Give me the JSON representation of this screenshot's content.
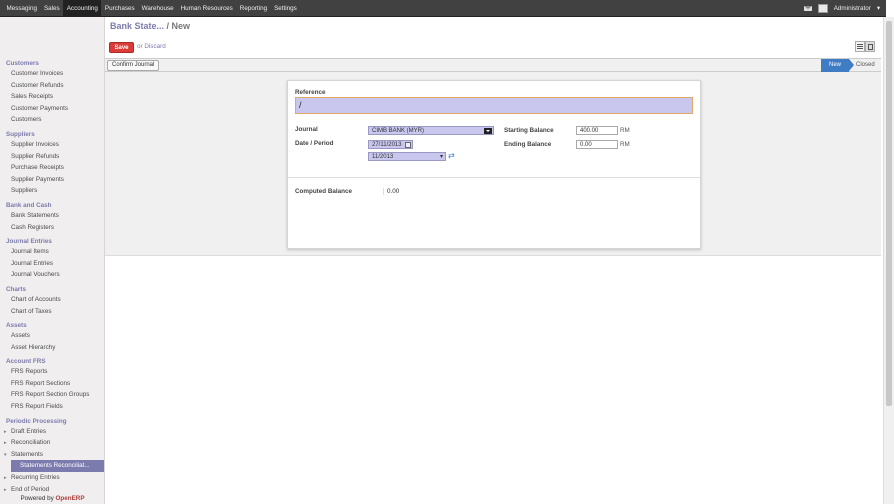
{
  "topbar": {
    "menu": [
      "Messaging",
      "Sales",
      "Accounting",
      "Purchases",
      "Warehouse",
      "Human Resources",
      "Reporting",
      "Settings"
    ],
    "active_index": 2,
    "user": "Administrator"
  },
  "sidebar": {
    "sections": [
      {
        "title": "Customers",
        "items": [
          "Customer Invoices",
          "Customer Refunds",
          "Sales Receipts",
          "Customer Payments",
          "Customers"
        ]
      },
      {
        "title": "Suppliers",
        "items": [
          "Supplier Invoices",
          "Supplier Refunds",
          "Purchase Receipts",
          "Supplier Payments",
          "Suppliers"
        ]
      },
      {
        "title": "Bank and Cash",
        "items": [
          "Bank Statements",
          "Cash Registers"
        ]
      },
      {
        "title": "Journal Entries",
        "items": [
          "Journal Items",
          "Journal Entries",
          "Journal Vouchers"
        ]
      },
      {
        "title": "Charts",
        "items": [
          "Chart of Accounts",
          "Chart of Taxes"
        ]
      },
      {
        "title": "Assets",
        "items": [
          "Assets",
          "Asset Hierarchy"
        ]
      },
      {
        "title": "Account FRS",
        "items": [
          "FRS Reports",
          "FRS Report Sections",
          "FRS Report Section Groups",
          "FRS Report Fields"
        ]
      },
      {
        "title": "Periodic Processing",
        "items": [
          "Draft Entries",
          "Reconciliation",
          "Statements",
          "Statements Reconciliat...",
          "Recurring Entries",
          "End of Period"
        ]
      }
    ],
    "powered_prefix": "Powered by ",
    "powered_brand": "OpenERP"
  },
  "header": {
    "breadcrumb_link": "Bank State...",
    "breadcrumb_current": "/ New",
    "save_label": "Save",
    "or_label": "or",
    "discard_label": "Discard"
  },
  "statusbar": {
    "confirm_label": "Confirm Journal",
    "states": [
      "New",
      "Closed"
    ],
    "active_state": "New"
  },
  "form": {
    "reference_label": "Reference",
    "reference_value": "/",
    "journal_label": "Journal",
    "journal_value": "CIMB BANK (MYR)",
    "date_period_label": "Date / Period",
    "date_value": "27/11/2013",
    "period_value": "11/2013",
    "starting_balance_label": "Starting Balance",
    "starting_balance_value": "400.00",
    "ending_balance_label": "Ending Balance",
    "ending_balance_value": "0.00",
    "currency": "RM",
    "computed_balance_label": "Computed Balance",
    "computed_balance_value": "0.00"
  },
  "colors": {
    "accent": "#7c7bad",
    "save": "#dc3b37",
    "status_active": "#3f7cc4",
    "required_field": "#c9c7ee"
  }
}
